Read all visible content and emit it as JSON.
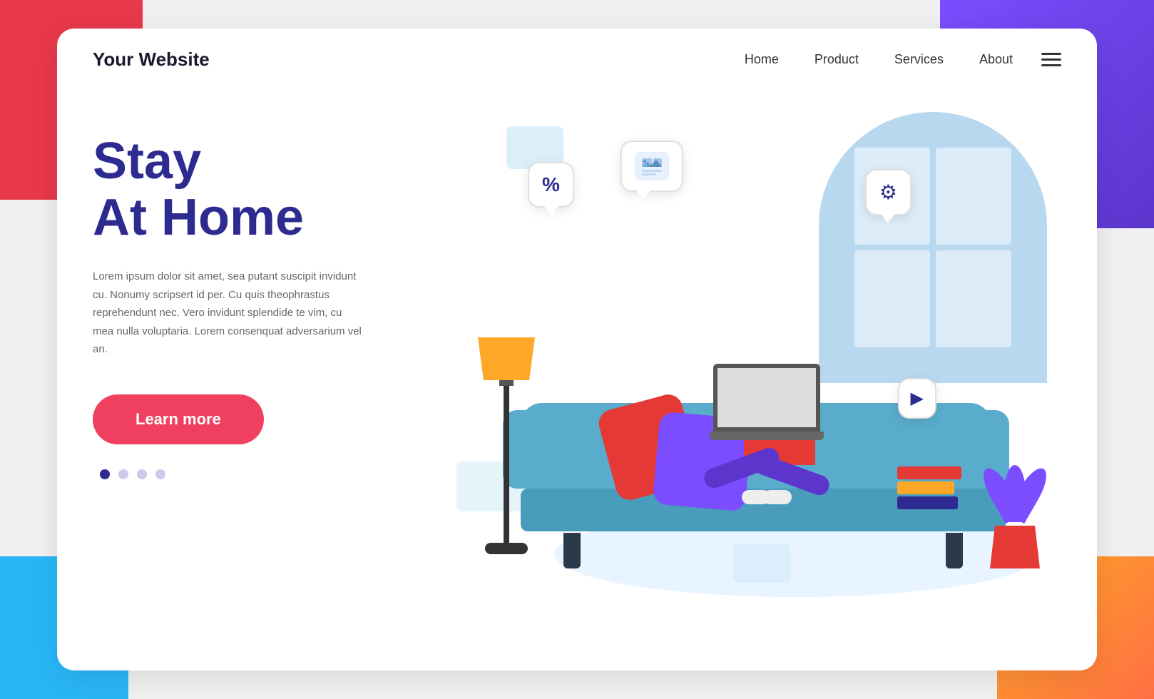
{
  "background": {
    "corner_tl_color": "#e8394a",
    "corner_tr_color": "#7c4dff",
    "corner_bl_color": "#29b6f6",
    "corner_br_color": "#ffa726"
  },
  "navbar": {
    "logo": "Your Website",
    "links": [
      {
        "label": "Home",
        "id": "home"
      },
      {
        "label": "Product",
        "id": "product"
      },
      {
        "label": "Services",
        "id": "services"
      },
      {
        "label": "About",
        "id": "about"
      }
    ],
    "hamburger_label": "menu"
  },
  "hero": {
    "title_line1": "Stay",
    "title_line2": "At Home",
    "description": "Lorem ipsum dolor sit amet, sea putant suscipit invidunt cu. Nonumy scripsert id per. Cu quis theophrastus reprehendunt nec. Vero invidunt splendide te vim, cu mea nulla voluptaria. Lorem consenquat adversarium vel an.",
    "cta_button": "Learn more",
    "dots": [
      {
        "active": true
      },
      {
        "active": false
      },
      {
        "active": false
      },
      {
        "active": false
      }
    ]
  },
  "bubbles": {
    "percent": "%",
    "gear": "⚙",
    "play": "▶",
    "image": "🖼"
  }
}
